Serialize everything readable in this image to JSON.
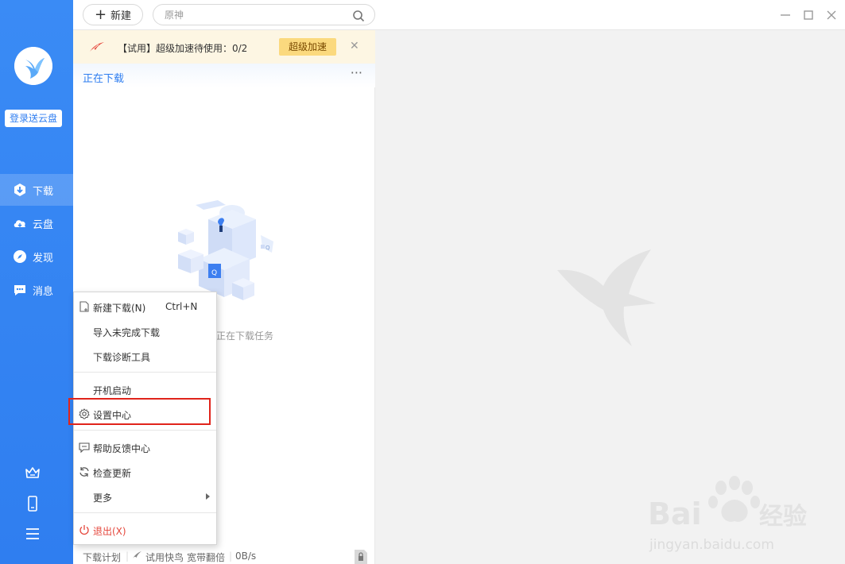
{
  "sidebar": {
    "login_label": "登录送云盘",
    "nav": [
      {
        "label": "下载",
        "icon": "download-icon",
        "active": true
      },
      {
        "label": "云盘",
        "icon": "cloud-icon",
        "active": false
      },
      {
        "label": "发现",
        "icon": "compass-icon",
        "active": false
      },
      {
        "label": "消息",
        "icon": "message-icon",
        "active": false
      }
    ],
    "bottom_icons": [
      "crown-icon",
      "phone-icon",
      "menu-icon"
    ]
  },
  "topbar": {
    "new_label": "新建",
    "search_value": "",
    "search_placeholder": "原神"
  },
  "promo": {
    "text": "【试用】超级加速待使用：0/2",
    "button": "超级加速"
  },
  "panel": {
    "section_label": "正在下载",
    "more_label": "···",
    "empty_text": "正在下载任务"
  },
  "statusbar": {
    "plan": "下载计划",
    "trial": "试用快鸟",
    "broadband": "宽带翻倍",
    "speed": "0B/s"
  },
  "context_menu": {
    "items": [
      {
        "label": "新建下载(N)",
        "shortcut": "Ctrl+N",
        "icon": "new-download-icon"
      },
      {
        "label": "导入未完成下载"
      },
      {
        "label": "下载诊断工具"
      },
      {
        "label": "开机启动"
      },
      {
        "label": "设置中心",
        "icon": "gear-icon",
        "highlighted": true
      },
      {
        "label": "帮助反馈中心",
        "icon": "feedback-icon"
      },
      {
        "label": "检查更新",
        "icon": "refresh-icon"
      },
      {
        "label": "更多",
        "has_submenu": true
      },
      {
        "label": "退出(X)",
        "icon": "power-icon",
        "color": "#e5463b"
      }
    ]
  },
  "watermark": {
    "brand": "Baidu经验",
    "url": "jingyan.baidu.com"
  },
  "colors": {
    "brand_blue": "#2f7ef0",
    "promo_bg": "#fdf6e3",
    "boost_btn": "#fbd97e",
    "highlight_red": "#e0241b"
  }
}
